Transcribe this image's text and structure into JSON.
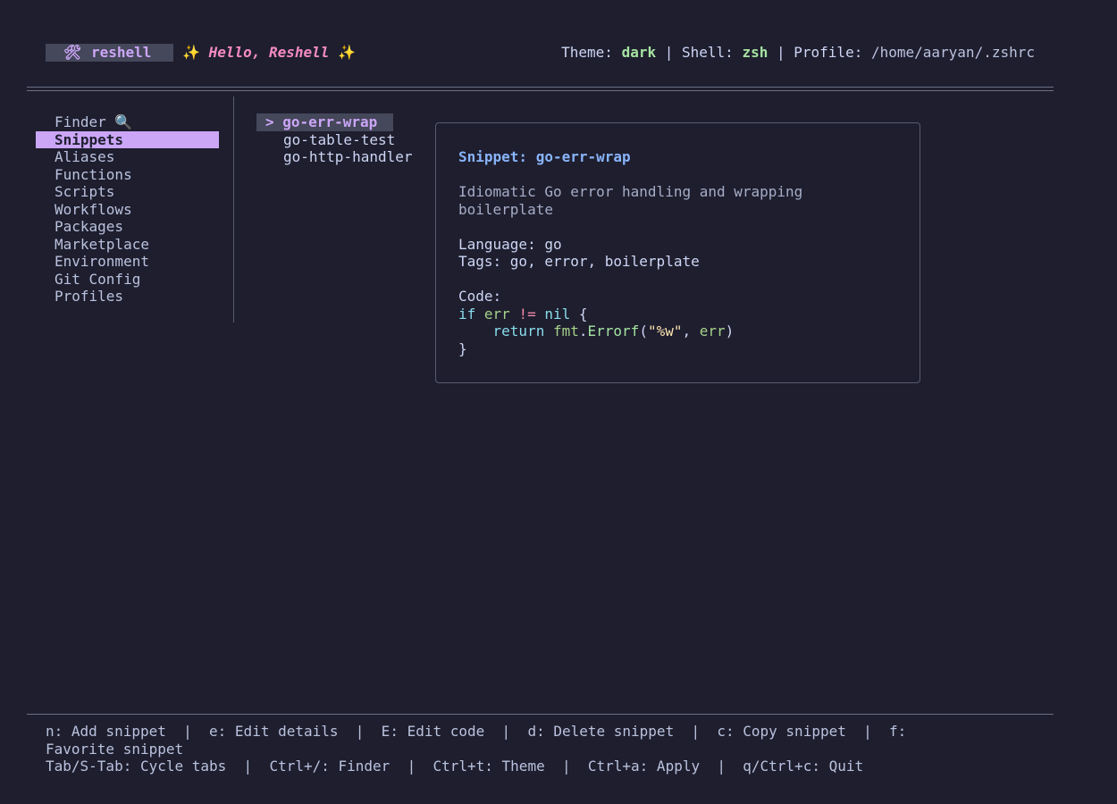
{
  "header": {
    "app_icon": "🛠",
    "app_name": "reshell",
    "greeting": "Hello, Reshell",
    "sparkle": "✨",
    "theme_label": "Theme: ",
    "theme_value": "dark",
    "sep": " | ",
    "shell_label": "Shell: ",
    "shell_value": "zsh",
    "profile_label": "Profile: ",
    "profile_value": "/home/aaryan/.zshrc"
  },
  "sidebar": {
    "items": [
      {
        "label": "Finder 🔍",
        "active": false
      },
      {
        "label": "Snippets",
        "active": true
      },
      {
        "label": "Aliases",
        "active": false
      },
      {
        "label": "Functions",
        "active": false
      },
      {
        "label": "Scripts",
        "active": false
      },
      {
        "label": "Workflows",
        "active": false
      },
      {
        "label": "Packages",
        "active": false
      },
      {
        "label": "Marketplace",
        "active": false
      },
      {
        "label": "Environment",
        "active": false
      },
      {
        "label": "Git Config",
        "active": false
      },
      {
        "label": "Profiles",
        "active": false
      }
    ]
  },
  "snippets": {
    "selected_marker": "> ",
    "items": [
      "go-err-wrap",
      "go-table-test",
      "go-http-handler"
    ]
  },
  "detail": {
    "title": "Snippet: go-err-wrap",
    "description_line1": "Idiomatic Go error handling and wrapping",
    "description_line2": "boilerplate",
    "language": "Language: go",
    "tags": "Tags: go, error, boilerplate",
    "code_label": "Code:",
    "code": {
      "l1_kw": "if",
      "l1_var": "err",
      "l1_op": "!=",
      "l1_nil": "nil",
      "l1_brace": "{",
      "l2_kw": "return",
      "l2_pkg": "fmt",
      "l2_dot": ".",
      "l2_fn": "Errorf",
      "l2_open": "(",
      "l2_str": "\"%w\"",
      "l2_comma": ", ",
      "l2_arg": "err",
      "l2_close": ")",
      "l3": "}"
    }
  },
  "footer": {
    "line1": "n: Add snippet  |  e: Edit details  |  E: Edit code  |  d: Delete snippet  |  c: Copy snippet  |  f:",
    "line2": "Favorite snippet",
    "line3": "Tab/S-Tab: Cycle tabs  |  Ctrl+/: Finder  |  Ctrl+t: Theme  |  Ctrl+a: Apply  |  q/Ctrl+c: Quit"
  },
  "colors": {
    "background": "#1e1e2e",
    "accent": "#cba6f7",
    "title": "#89b4fa",
    "green": "#a6e3a1",
    "pink": "#f38ba8"
  }
}
